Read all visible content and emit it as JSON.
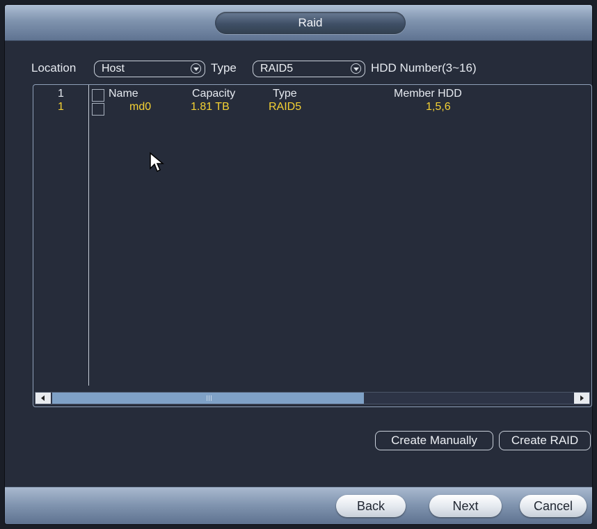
{
  "window": {
    "title": "Raid"
  },
  "filters": {
    "location_label": "Location",
    "location_value": "Host",
    "type_label": "Type",
    "type_value": "RAID5",
    "hdd_number_label": "HDD Number(3~16)"
  },
  "table": {
    "header": {
      "index": "1",
      "name": "Name",
      "capacity": "Capacity",
      "type": "Type",
      "member": "Member HDD"
    },
    "rows": [
      {
        "index": "1",
        "name": "md0",
        "capacity": "1.81 TB",
        "type": "RAID5",
        "member": "1,5,6"
      }
    ]
  },
  "actions": {
    "create_manually": "Create Manually",
    "create_raid": "Create RAID"
  },
  "footer": {
    "back": "Back",
    "next": "Next",
    "cancel": "Cancel"
  },
  "colors": {
    "row_text": "#f5d233",
    "scroll_thumb": "#7fa1c6",
    "background": "#262c3a"
  },
  "icons": [
    "dropdown-arrow-icon",
    "scroll-left-icon",
    "scroll-right-icon",
    "mouse-cursor-icon"
  ]
}
